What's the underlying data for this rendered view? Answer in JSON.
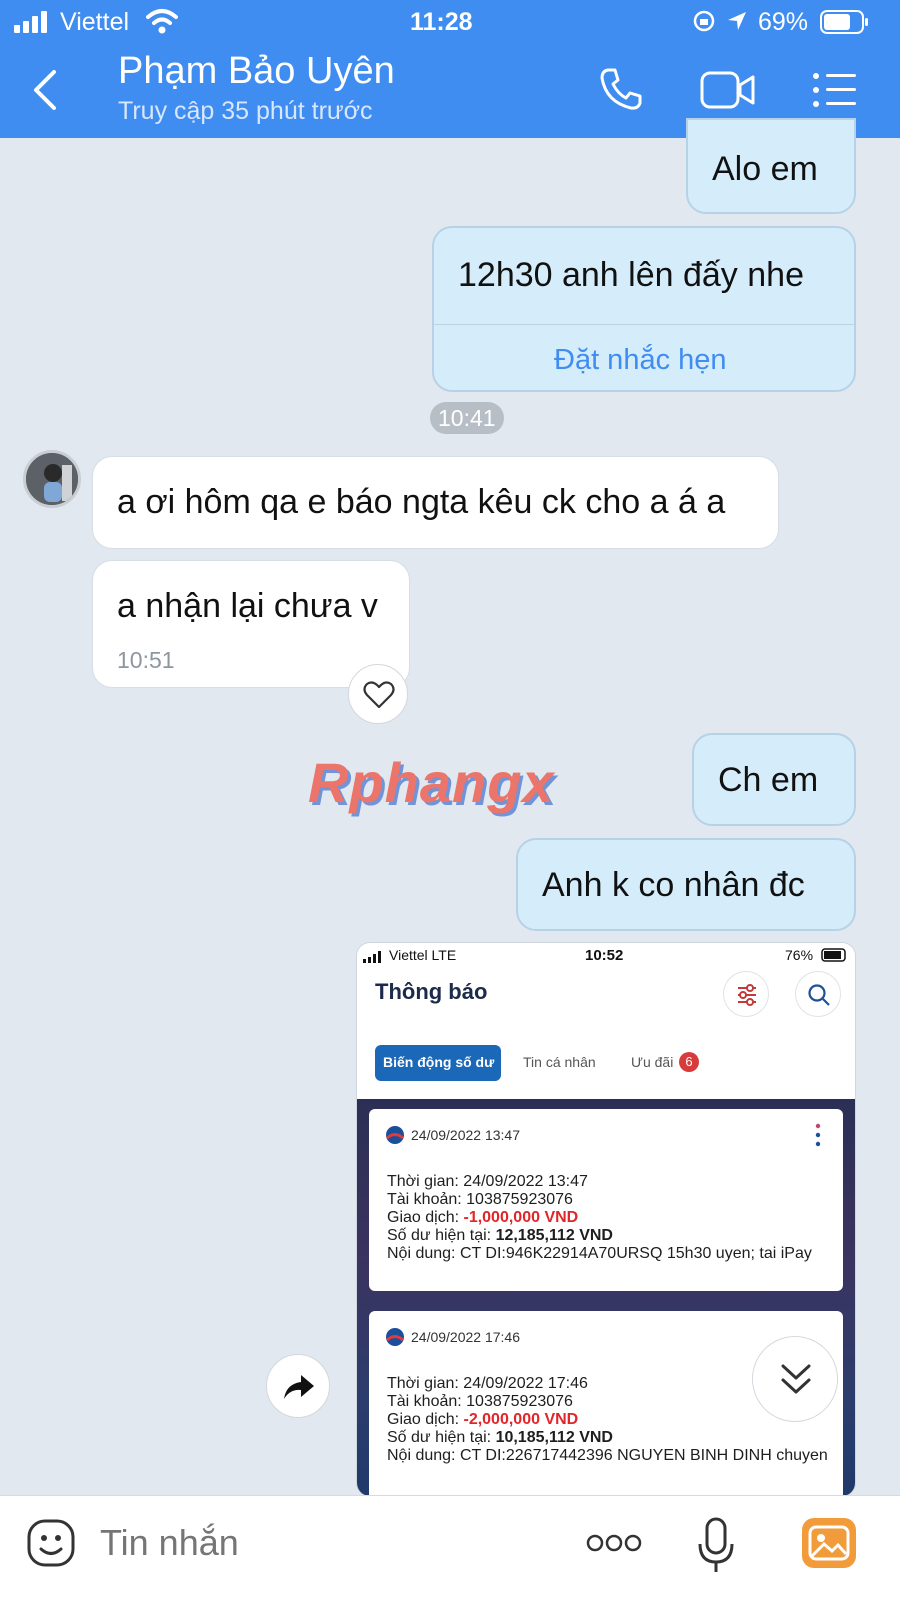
{
  "status_bar": {
    "carrier": "Viettel",
    "time": "11:28",
    "battery": "69%"
  },
  "header": {
    "contact_name": "Phạm Bảo Uyên",
    "last_seen": "Truy cập 35 phút trước",
    "icons": [
      "back-icon",
      "phone-icon",
      "video-icon",
      "menu-icon"
    ]
  },
  "messages": {
    "m1": "Alo em",
    "m2": "12h30 anh lên đấy nhe",
    "m2_action": "Đặt nhắc hẹn",
    "time_1": "10:41",
    "m3": "a ơi hôm qa e báo ngta kêu ck cho a á a",
    "m4": "a nhận lại chưa v",
    "m4_time": "10:51",
    "m5": "Ch em",
    "m6": "Anh k co nhân đc"
  },
  "watermark": "Rphangx",
  "shared_image": {
    "carrier": "Viettel  LTE",
    "time": "10:52",
    "battery": "76%",
    "title": "Thông báo",
    "tabs": [
      "Biến động số dư",
      "Tin cá nhân",
      "Ưu đãi"
    ],
    "offer_badge": "6",
    "cards": [
      {
        "date": "24/09/2022 13:47",
        "time_line": "Thời gian: 24/09/2022 13:47",
        "account": "Tài khoản: 103875923076",
        "tx_label": "Giao dịch: ",
        "tx_value": "-1,000,000 VND",
        "bal_label": "Số dư hiện tại: ",
        "bal_value": "12,185,112 VND",
        "content": "Nội dung: CT DI:946K22914A70URSQ 15h30 uyen; tai iPay"
      },
      {
        "date": "24/09/2022 17:46",
        "time_line": "Thời gian: 24/09/2022 17:46",
        "account": "Tài khoản: 103875923076",
        "tx_label": "Giao dịch: ",
        "tx_value": "-2,000,000 VND",
        "bal_label": "Số dư hiện tại: ",
        "bal_value": "10,185,112 VND",
        "content": "Nội dung: CT DI:226717442396 NGUYEN BINH DINH chuyen"
      }
    ]
  },
  "input": {
    "placeholder": "Tin nhắn"
  },
  "colors": {
    "header": "#3f8df0",
    "outgoing": "#d5ecfb",
    "incoming": "#ffffff",
    "accent": "#3f8df0"
  }
}
